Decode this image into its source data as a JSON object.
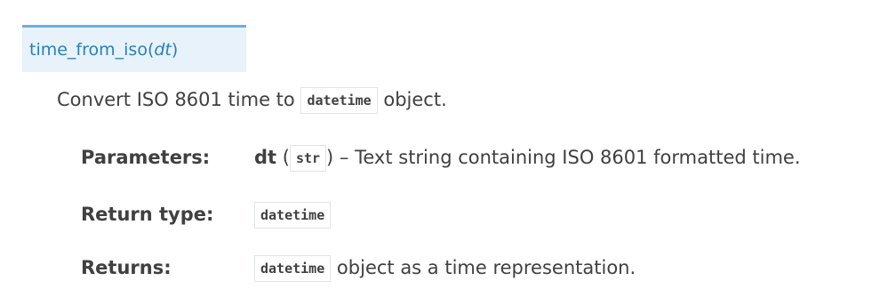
{
  "signature": {
    "function_name": "time_from_iso",
    "open_paren": "(",
    "param": "dt",
    "close_paren": ")"
  },
  "description": {
    "before": "Convert ISO 8601 time to ",
    "code": "datetime",
    "after": " object."
  },
  "fields": {
    "parameters": {
      "label": "Parameters:",
      "param_name": "dt",
      "open": " (",
      "type": "str",
      "close": ")",
      "text": " – Text string containing ISO 8601 formatted time."
    },
    "return_type": {
      "label": "Return type:",
      "code": "datetime"
    },
    "returns": {
      "label": "Returns:",
      "code": "datetime",
      "text": " object as a time representation."
    }
  }
}
